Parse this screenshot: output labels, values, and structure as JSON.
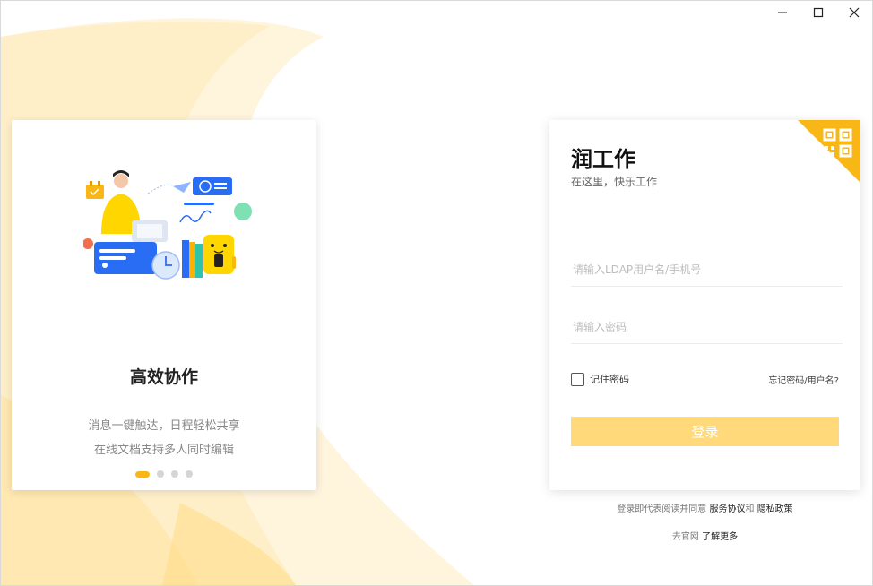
{
  "window": {
    "controls": [
      "minimize-icon",
      "maximize-icon",
      "close-icon"
    ]
  },
  "promo": {
    "title": "高效协作",
    "line1": "消息一键触达，日程轻松共享",
    "line2": "在线文档支持多人同时编辑",
    "slide_count": 4,
    "active_slide": 0,
    "illustration_icon": "collaboration-illustration-icon"
  },
  "login": {
    "app_title": "润工作",
    "subtitle": "在这里，快乐工作",
    "username_placeholder": "请输入LDAP用户名/手机号",
    "username_value": "",
    "password_placeholder": "请输入密码",
    "password_value": "",
    "remember_label": "记住密码",
    "remember_checked": false,
    "forgot_label": "忘记密码/用户名?",
    "submit_label": "登录",
    "qr_icon": "qr-code-icon"
  },
  "footer": {
    "agreement_prefix": "登录即代表阅读并同意",
    "terms_label": "服务协议",
    "and_label": "和",
    "privacy_label": "隐私政策",
    "official_prefix": "去官网",
    "learn_more_label": "了解更多"
  },
  "colors": {
    "accent": "#f9b717",
    "button_disabled": "#ffd97a",
    "background_shape": "#fff2d6"
  }
}
